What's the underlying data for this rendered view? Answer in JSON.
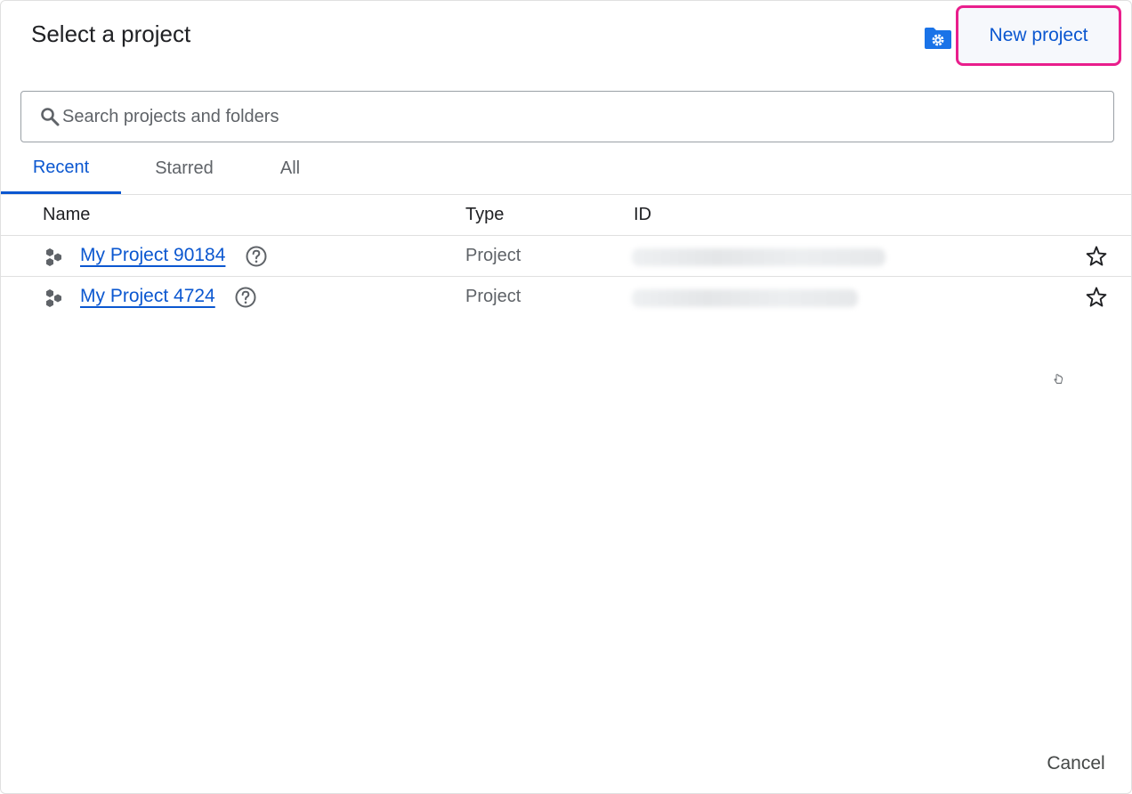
{
  "dialog": {
    "title": "Select a project",
    "folder_settings_icon": "folder-gear-icon",
    "new_project_label": "New project",
    "accent_color": "#0b57d0",
    "highlight_color": "#e91e8c"
  },
  "search": {
    "placeholder": "Search projects and folders",
    "value": "",
    "icon": "search-icon"
  },
  "tabs": [
    {
      "label": "Recent",
      "active": true
    },
    {
      "label": "Starred",
      "active": false
    },
    {
      "label": "All",
      "active": false
    }
  ],
  "table": {
    "columns": [
      "Name",
      "Type",
      "ID"
    ],
    "rows": [
      {
        "name": "My Project 90184",
        "type": "Project",
        "id": "",
        "icon": "project-hexagons-icon",
        "starred": false
      },
      {
        "name": "My Project 4724",
        "type": "Project",
        "id": "",
        "icon": "project-hexagons-icon",
        "starred": false
      }
    ]
  },
  "footer": {
    "cancel_label": "Cancel"
  }
}
